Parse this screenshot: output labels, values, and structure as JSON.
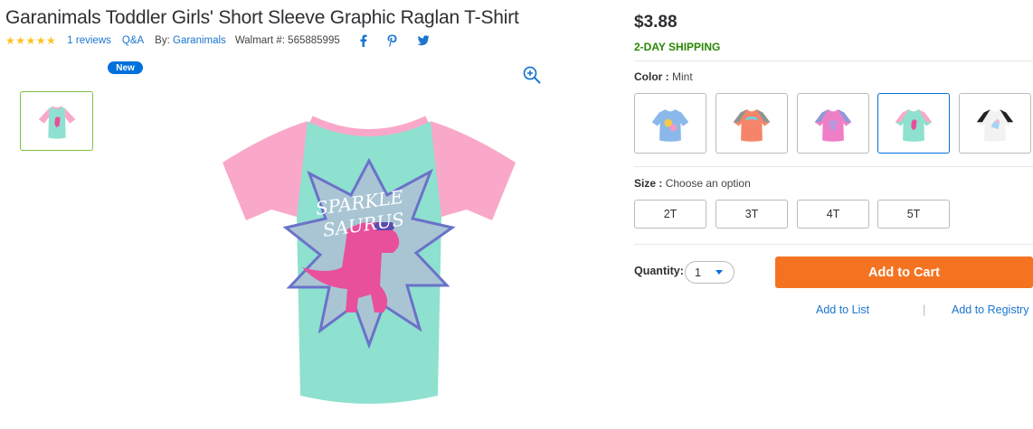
{
  "product": {
    "title": "Garanimals Toddler Girls' Short Sleeve Graphic Raglan T-Shirt",
    "rating_stars": "★★★★★",
    "rating_value": 5,
    "reviews_link": "1 reviews",
    "qa_link": "Q&A",
    "by_prefix": "By:",
    "brand_link": "Garanimals",
    "walmart_number": "Walmart #: 565885995",
    "badge": "New"
  },
  "social": {
    "icons": [
      "facebook-icon",
      "pinterest-icon",
      "twitter-icon"
    ]
  },
  "pricing": {
    "price": "$3.88",
    "shipping": "2-DAY SHIPPING"
  },
  "color": {
    "label": "Color :",
    "selected": "Mint",
    "swatches": [
      "Light Blue",
      "Coral",
      "Pink",
      "Mint",
      "Black/White"
    ]
  },
  "size": {
    "label": "Size :",
    "placeholder": "Choose an option",
    "options": [
      "2T",
      "3T",
      "4T",
      "5T"
    ]
  },
  "quantity": {
    "label": "Quantity:",
    "value": "1"
  },
  "actions": {
    "add_to_cart": "Add to Cart",
    "add_to_list": "Add to List",
    "separator": "|",
    "add_to_registry": "Add to Registry"
  },
  "colors": {
    "accent_blue": "#0071dc",
    "link_blue": "#1a75cf",
    "cart_orange": "#f47321",
    "shipping_green": "#2a8703",
    "star_yellow": "#ffc220"
  }
}
